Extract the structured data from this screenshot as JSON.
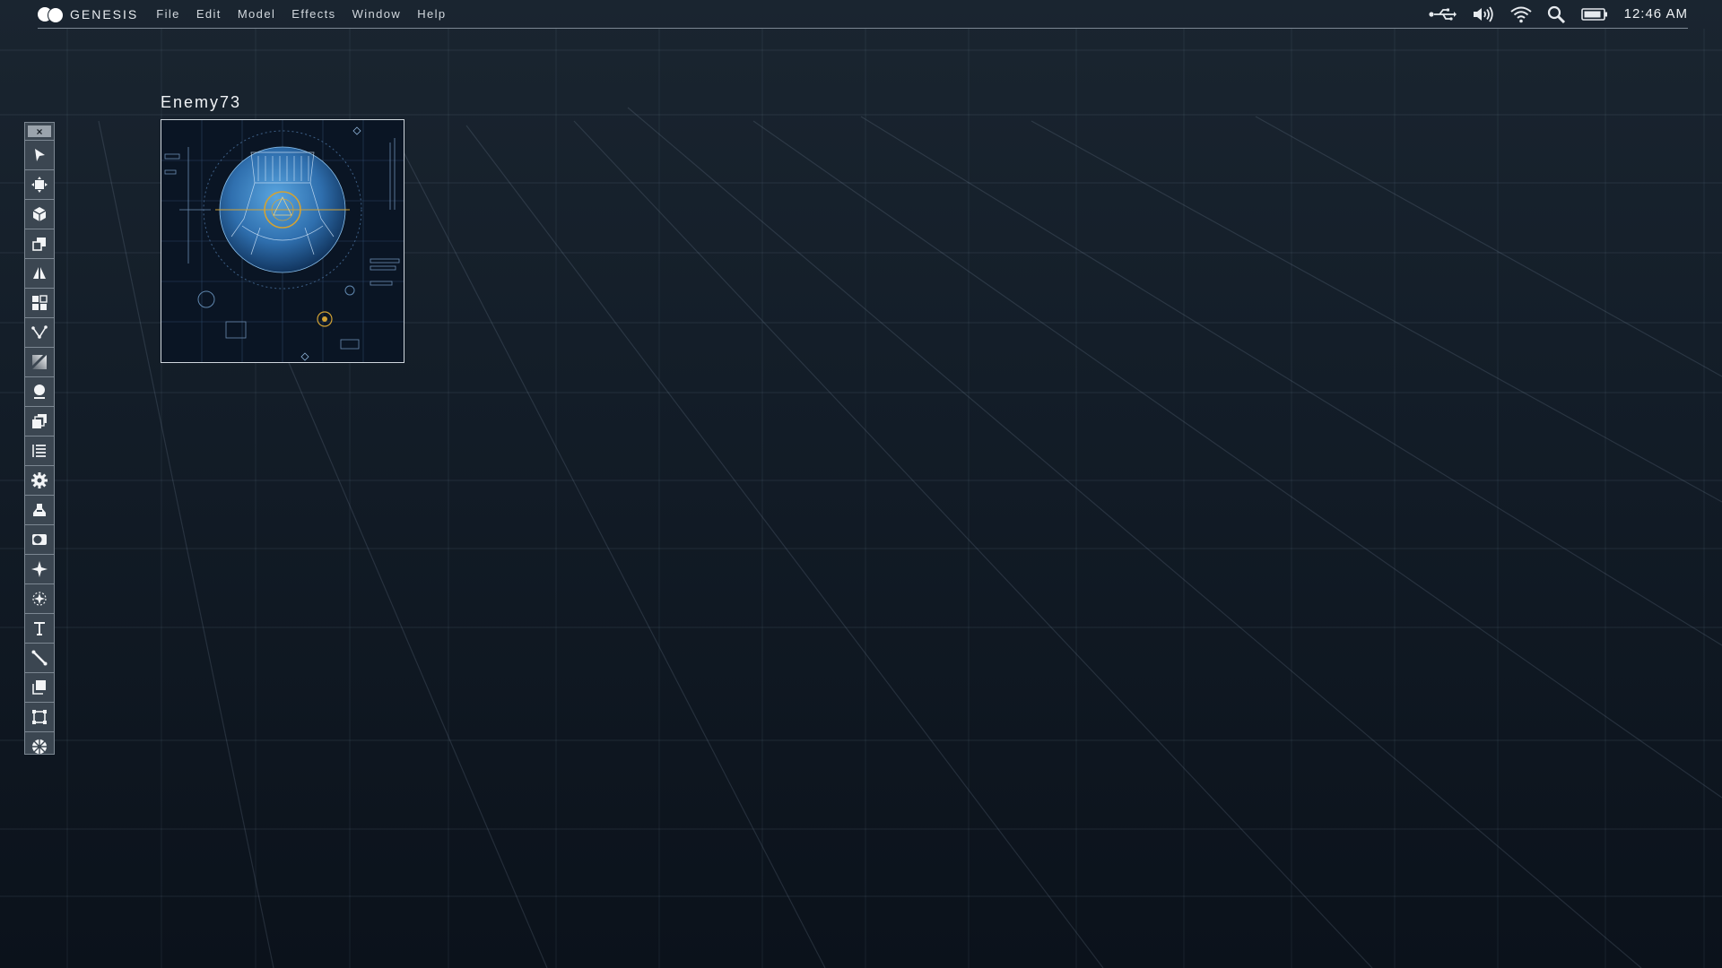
{
  "menubar": {
    "app_name": "GENESIS",
    "menus": [
      "File",
      "Edit",
      "Model",
      "Effects",
      "Window",
      "Help"
    ],
    "status_icons": [
      "usb-icon",
      "volume-icon",
      "wifi-icon",
      "search-icon",
      "battery-icon"
    ],
    "clock": "12:46 AM"
  },
  "toolbox": {
    "tools": [
      "select-arrow-icon",
      "move-icon",
      "cube-icon",
      "duplicate-box-icon",
      "mirror-icon",
      "grid-tiles-icon",
      "vertex-path-icon",
      "gradient-fill-icon",
      "sculpt-blob-icon",
      "copy-stack-icon",
      "list-icon",
      "gear-icon",
      "paint-bucket-icon",
      "contrast-toggle-icon",
      "sparkle-icon",
      "light-source-icon",
      "text-tool-icon",
      "line-tool-icon",
      "layer-icon",
      "crop-frame-icon",
      "aperture-icon"
    ]
  },
  "window": {
    "title": "Enemy73"
  },
  "colors": {
    "background": "#131d28",
    "menubar_line": "#7d8894",
    "accent_gold": "#d2a234",
    "accent_blue": "#3f8ed1"
  }
}
